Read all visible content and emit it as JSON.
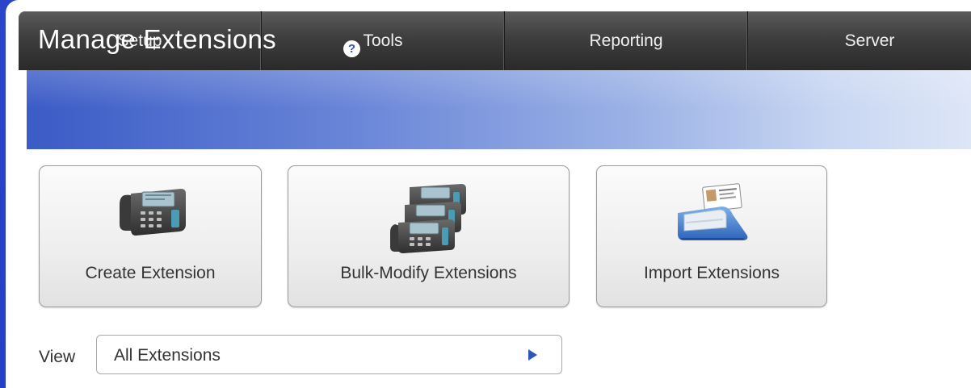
{
  "nav": {
    "tabs": [
      {
        "label": "Setup"
      },
      {
        "label": "Tools"
      },
      {
        "label": "Reporting"
      },
      {
        "label": "Server"
      }
    ]
  },
  "header": {
    "title": "Manage Extensions",
    "help_icon": "question-circle-icon"
  },
  "actions": {
    "create": {
      "label": "Create Extension",
      "icon": "desk-phone-icon"
    },
    "bulk": {
      "label": "Bulk-Modify Extensions",
      "icon": "stacked-phones-icon"
    },
    "import": {
      "label": "Import Extensions",
      "icon": "card-import-icon"
    }
  },
  "view": {
    "label": "View",
    "selected": "All Extensions",
    "arrow_icon": "triangle-right-icon"
  },
  "colors": {
    "nav_bg": "#3e3e3e",
    "header_accent": "#3b5bc6",
    "select_arrow": "#2e55b8"
  }
}
